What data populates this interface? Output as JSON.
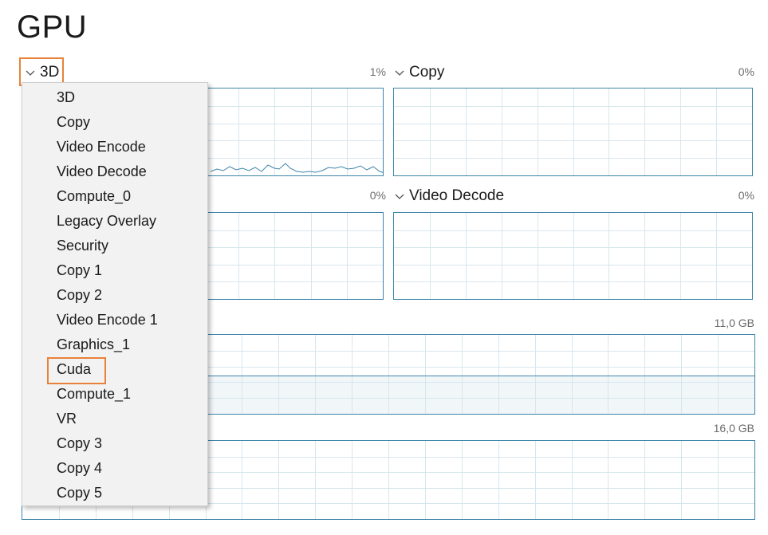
{
  "page_title": "GPU",
  "colors": {
    "accent_border": "#3f86aa",
    "highlight": "#e8823a",
    "grid": "#d7e6ee",
    "memory_fill": "#f1f6f9"
  },
  "engines": [
    {
      "label": "3D",
      "percent": "1%"
    },
    {
      "label": "Copy",
      "percent": "0%"
    },
    {
      "label": "",
      "percent": "0%"
    },
    {
      "label": "Video Decode",
      "percent": "0%"
    }
  ],
  "memory": [
    {
      "max": "11,0 GB"
    },
    {
      "max": "16,0 GB"
    }
  ],
  "dropdown": {
    "items": [
      "3D",
      "Copy",
      "Video Encode",
      "Video Decode",
      "Compute_0",
      "Legacy Overlay",
      "Security",
      "Copy 1",
      "Copy 2",
      "Video Encode 1",
      "Graphics_1",
      "Cuda",
      "Compute_1",
      "VR",
      "Copy 3",
      "Copy 4",
      "Copy 5"
    ],
    "highlighted": "Cuda"
  },
  "icons": {
    "chevron": "chevron-down-icon"
  }
}
